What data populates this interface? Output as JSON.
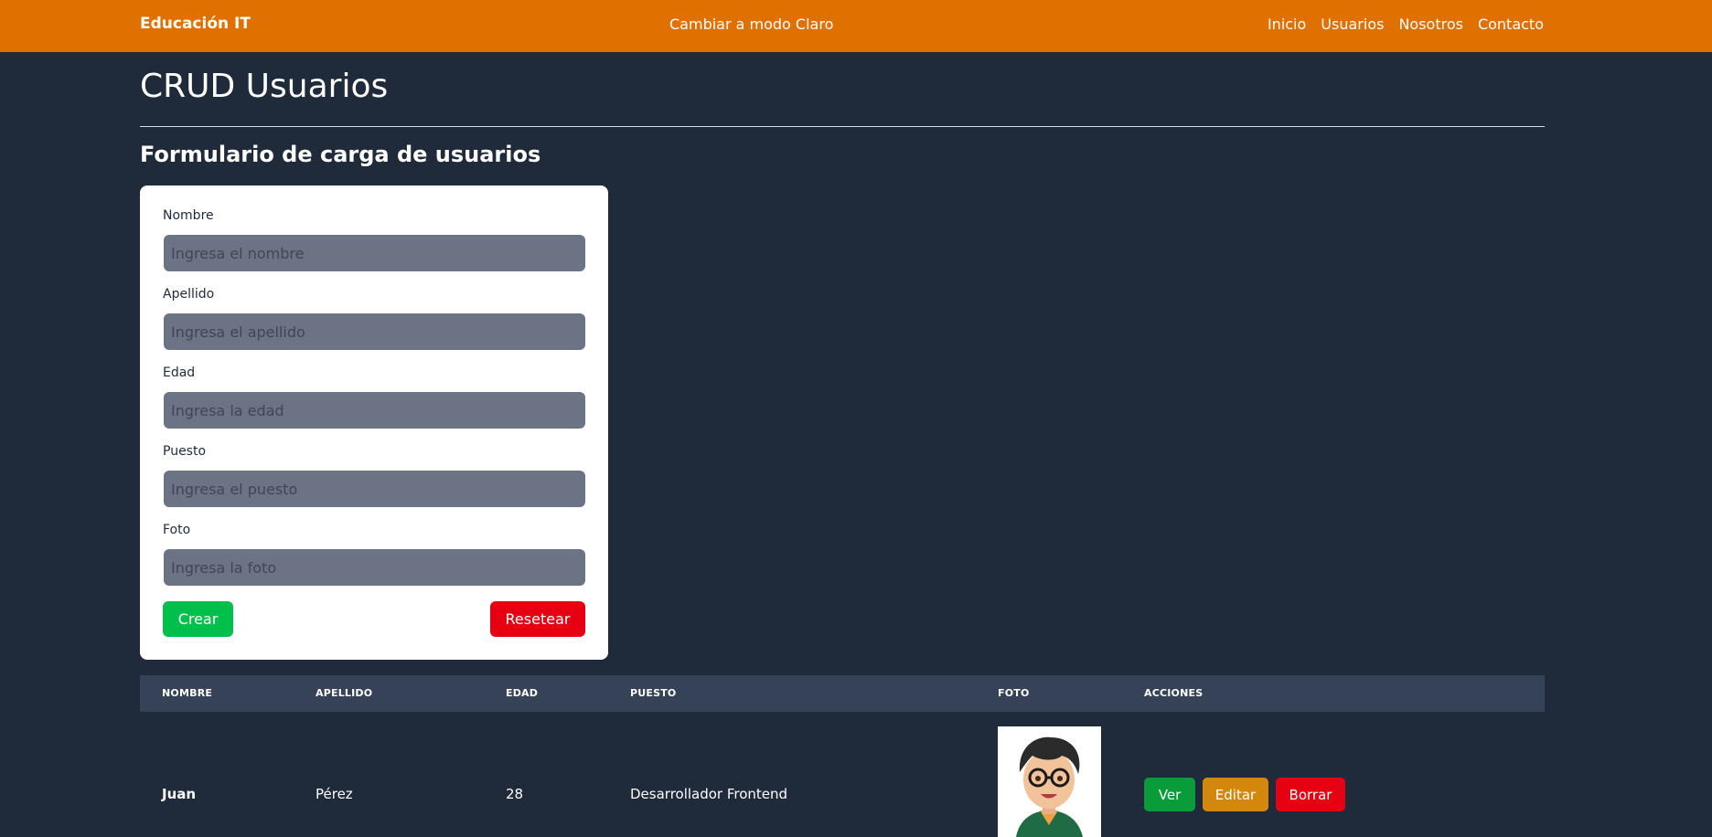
{
  "navbar": {
    "brand": "Educación IT",
    "mode_toggle": "Cambiar a modo Claro",
    "links": [
      "Inicio",
      "Usuarios",
      "Nosotros",
      "Contacto"
    ],
    "color": "#e07000"
  },
  "page": {
    "title": "CRUD Usuarios",
    "form_title": "Formulario de carga de usuarios"
  },
  "form": {
    "fields": [
      {
        "label": "Nombre",
        "placeholder": "Ingresa el nombre",
        "value": ""
      },
      {
        "label": "Apellido",
        "placeholder": "Ingresa el apellido",
        "value": ""
      },
      {
        "label": "Edad",
        "placeholder": "Ingresa la edad",
        "value": ""
      },
      {
        "label": "Puesto",
        "placeholder": "Ingresa el puesto",
        "value": ""
      },
      {
        "label": "Foto",
        "placeholder": "Ingresa la foto",
        "value": ""
      }
    ],
    "create_label": "Crear",
    "reset_label": "Resetear"
  },
  "table": {
    "headers": [
      "NOMBRE",
      "APELLIDO",
      "EDAD",
      "PUESTO",
      "FOTO",
      "ACCIONES"
    ],
    "rows": [
      {
        "nombre": "Juan",
        "apellido": "Pérez",
        "edad": "28",
        "puesto": "Desarrollador Frontend",
        "foto_icon": "avatar-icon"
      }
    ],
    "actions": {
      "ver": "Ver",
      "editar": "Editar",
      "borrar": "Borrar"
    }
  },
  "colors": {
    "background": "#1f2a3b",
    "create": "#00c04b",
    "reset": "#e60012",
    "ver": "#0a9b3a",
    "editar": "#d4870d",
    "borrar": "#e60012"
  }
}
